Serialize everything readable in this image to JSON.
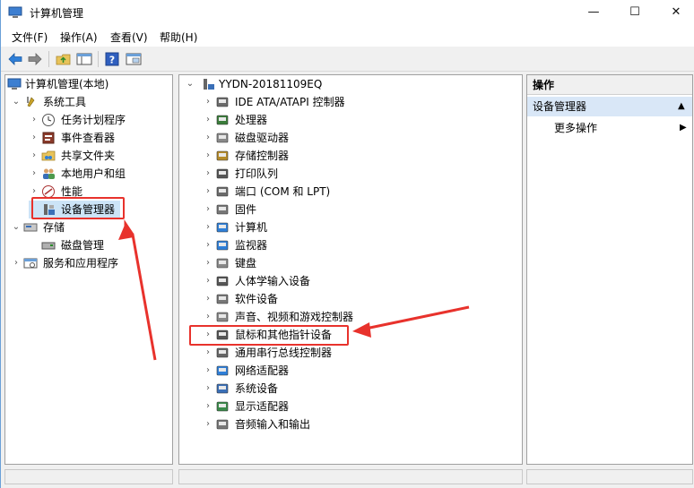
{
  "window": {
    "title": "计算机管理",
    "controls": {
      "minimize": "—",
      "maximize": "☐",
      "close": "✕"
    }
  },
  "menu": [
    "文件(F)",
    "操作(A)",
    "查看(V)",
    "帮助(H)"
  ],
  "toolbar": {
    "icons": [
      "back-arrow-icon",
      "forward-arrow-icon",
      "up-folder-icon",
      "show-hide-tree-icon",
      "help-icon",
      "console-view-icon"
    ]
  },
  "left_tree": {
    "root": "计算机管理(本地)",
    "system_tools": "系统工具",
    "system_children": [
      "任务计划程序",
      "事件查看器",
      "共享文件夹",
      "本地用户和组",
      "性能",
      "设备管理器"
    ],
    "storage": "存储",
    "storage_children": [
      "磁盘管理"
    ],
    "services": "服务和应用程序"
  },
  "device_tree": {
    "computer_name": "YYDN-20181109EQ",
    "categories": [
      "IDE ATA/ATAPI 控制器",
      "处理器",
      "磁盘驱动器",
      "存储控制器",
      "打印队列",
      "端口 (COM 和 LPT)",
      "固件",
      "计算机",
      "监视器",
      "键盘",
      "人体学输入设备",
      "软件设备",
      "声音、视频和游戏控制器",
      "鼠标和其他指针设备",
      "通用串行总线控制器",
      "网络适配器",
      "系统设备",
      "显示适配器",
      "音频输入和输出"
    ]
  },
  "actions": {
    "header": "操作",
    "selected": "设备管理器",
    "more": "更多操作"
  },
  "colors": {
    "annotation_red": "#e8322c",
    "selection_blue": "#d9e7f7"
  }
}
